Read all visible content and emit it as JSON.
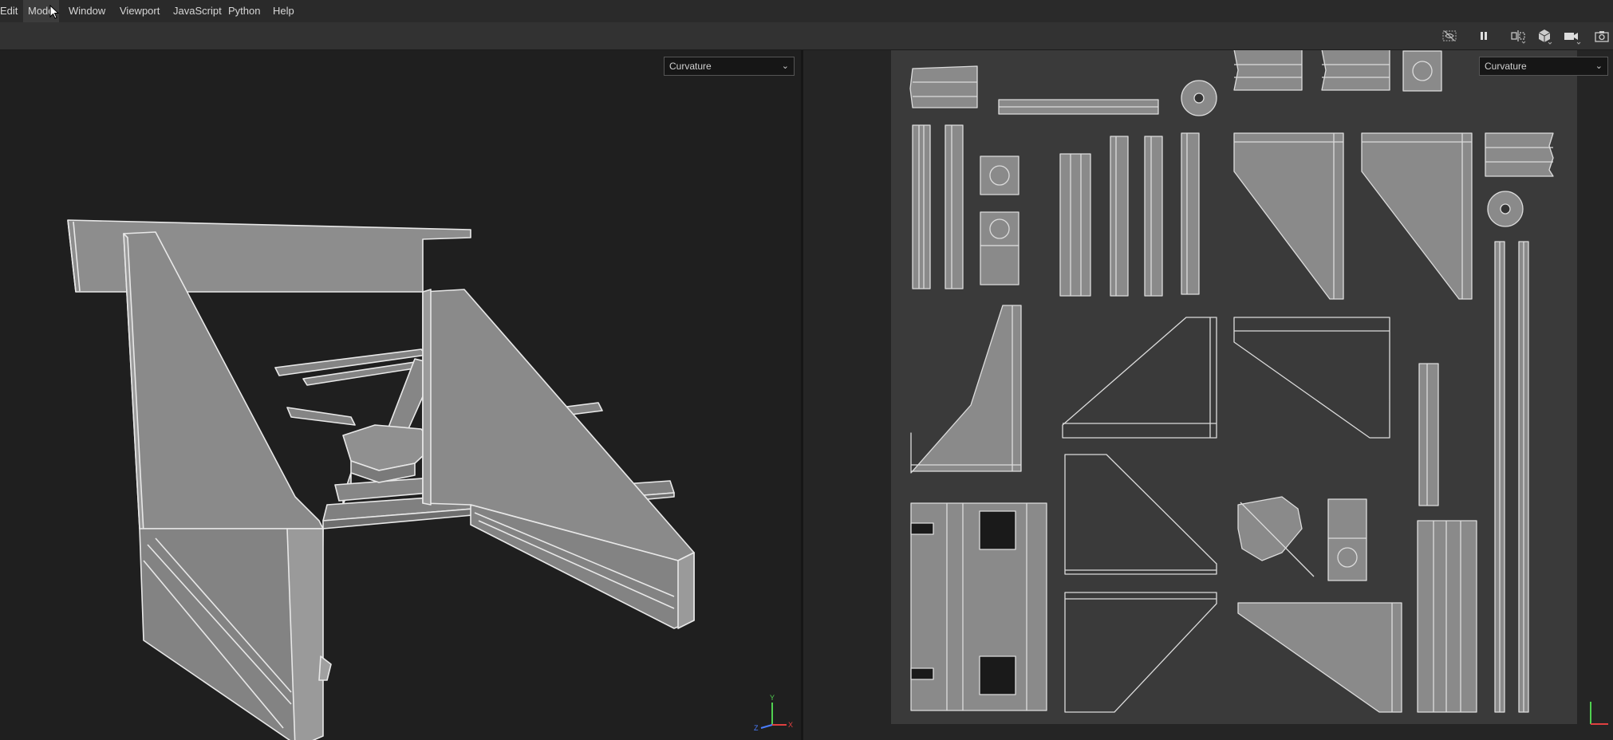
{
  "menubar": {
    "items": [
      {
        "label": "Edit"
      },
      {
        "label": "Mode"
      },
      {
        "label": "Window"
      },
      {
        "label": "Viewport"
      },
      {
        "label": "JavaScript"
      },
      {
        "label": "Python"
      },
      {
        "label": "Help"
      }
    ],
    "active_index": 1
  },
  "toolbar": {
    "icons": [
      "hide-icon",
      "pause-icon",
      "symmetry-icon",
      "cube-view-icon",
      "camera-video-icon",
      "screenshot-icon"
    ]
  },
  "viewport3d": {
    "channel_select": {
      "value": "Curvature"
    },
    "gizmo": {
      "x": "X",
      "y": "Y",
      "z": "Z",
      "x_color": "#e04040",
      "y_color": "#50d050",
      "z_color": "#4a7dff"
    }
  },
  "viewport2d": {
    "channel_select": {
      "value": "Curvature"
    }
  },
  "colors": {
    "mesh_fill": "#8a8a8a",
    "wire": "#e8e8e8",
    "uv_tile_bg": "#3a3a3a",
    "active_menu_bg": "#3c3c3c"
  }
}
